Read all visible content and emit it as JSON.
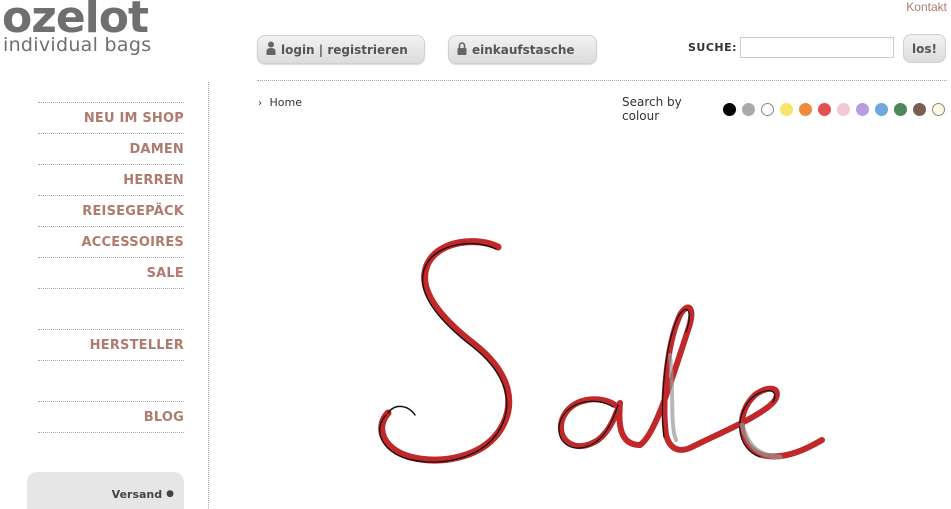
{
  "logo": {
    "main": "ozelot",
    "sub": "individual bags"
  },
  "header": {
    "kontakt": "Kontakt",
    "login_label": "login | registrieren",
    "bag_label": "einkaufstasche",
    "search_label": "SUCHE:",
    "search_value": "",
    "search_button": "los!"
  },
  "sidebar": {
    "items": [
      {
        "label": "NEU IM SHOP"
      },
      {
        "label": "DAMEN"
      },
      {
        "label": "HERREN"
      },
      {
        "label": "REISEGEPÄCK"
      },
      {
        "label": "ACCESSOIRES"
      },
      {
        "label": "SALE"
      }
    ],
    "hersteller": "HERSTELLER",
    "blog": "BLOG",
    "versand": "Versand"
  },
  "breadcrumb": {
    "home": "Home"
  },
  "colour_filter": {
    "label": "Search by colour",
    "colours": [
      "#000000",
      "#aaaaaa",
      "#ffffff",
      "#f7e36b",
      "#f08a3c",
      "#e45050",
      "#f5c6d6",
      "#b99be0",
      "#6fa8dc",
      "#4a8a5a",
      "#7a5e52",
      "#fdf8df"
    ]
  },
  "hero": {
    "text": "Sale"
  }
}
